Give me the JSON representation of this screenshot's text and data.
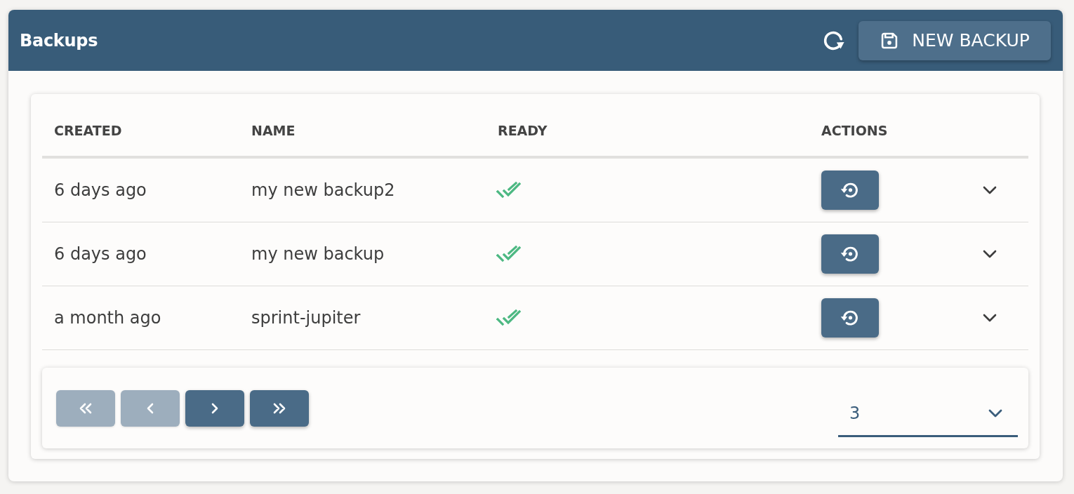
{
  "header": {
    "title": "Backups",
    "new_backup_label": "NEW BACKUP"
  },
  "table": {
    "columns": [
      "CREATED",
      "NAME",
      "READY",
      "ACTIONS"
    ],
    "rows": [
      {
        "created": "6 days ago",
        "name": "my new backup2",
        "ready": true,
        "expanded": false
      },
      {
        "created": "6 days ago",
        "name": "my new backup",
        "ready": true,
        "expanded": false
      },
      {
        "created": "a month ago",
        "name": "sprint-jupiter",
        "ready": true,
        "expanded": false
      }
    ]
  },
  "pagination": {
    "buttons": [
      {
        "kind": "first",
        "disabled": true
      },
      {
        "kind": "prev",
        "disabled": true
      },
      {
        "kind": "next",
        "disabled": false
      },
      {
        "kind": "last",
        "disabled": false
      }
    ],
    "page_size": "3"
  }
}
